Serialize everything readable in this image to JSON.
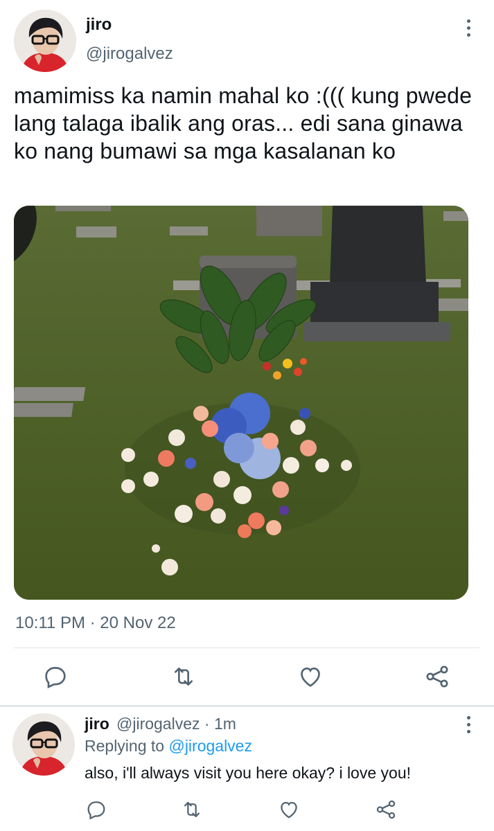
{
  "tweet": {
    "display_name": "jiro",
    "handle": "@jirogalvez",
    "text": "mamimiss ka namin mahal ko :((( kung pwede lang talaga ibalik ang oras... edi sana ginawa ko nang bumawi sa mga kasalanan ko",
    "timestamp": "10:11 PM · 20 Nov 22",
    "image_icon": "grave-with-flowers-photo",
    "actions": [
      "reply-icon",
      "retweet-icon",
      "like-icon",
      "share-icon"
    ]
  },
  "reply": {
    "display_name": "jiro",
    "handle_time": "@jirogalvez · 1m",
    "replying_label": "Replying to",
    "replying_to": "@jirogalvez",
    "text": "also, i'll always visit you here okay? i love you!",
    "actions": [
      "reply-icon",
      "retweet-icon",
      "like-icon",
      "share-icon"
    ]
  },
  "colors": {
    "text": "#0f1419",
    "secondary": "#536471",
    "link": "#1d9bf0",
    "divider": "#dde3e6"
  }
}
